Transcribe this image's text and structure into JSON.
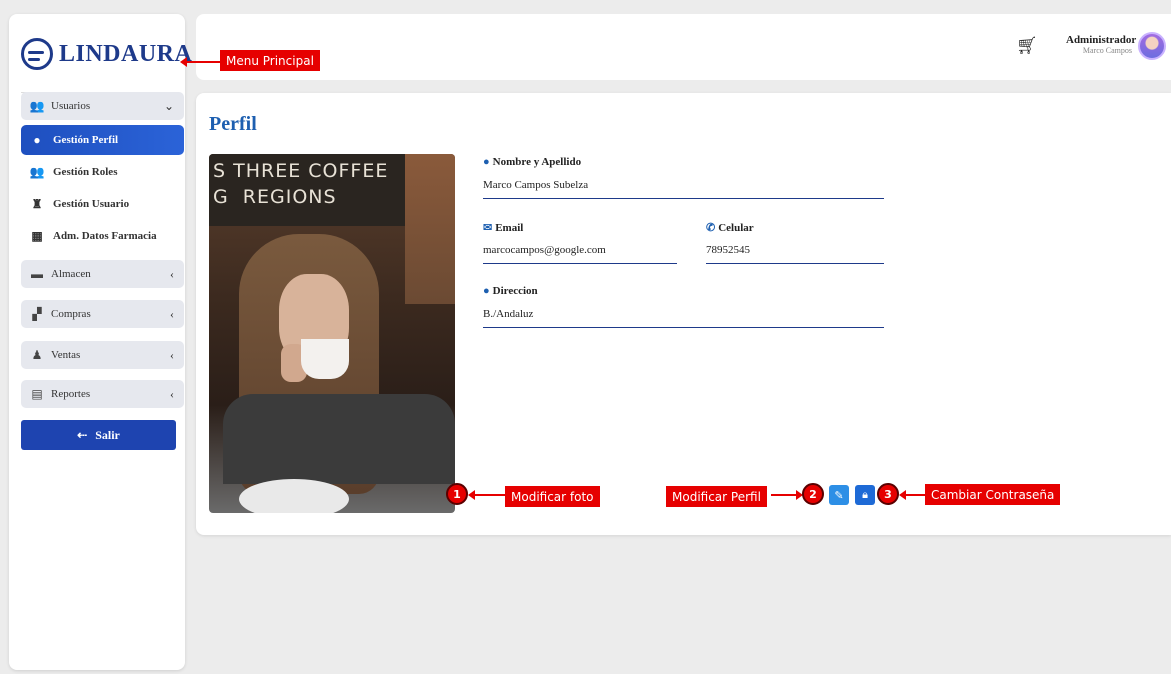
{
  "brand": {
    "name": "LINDAURA"
  },
  "sidebar": {
    "groups": [
      {
        "label": "Usuarios",
        "icon": "users-icon",
        "chevron": "⌄"
      },
      {
        "label": "Almacen",
        "icon": "box-icon",
        "chevron": "‹"
      },
      {
        "label": "Compras",
        "icon": "cart-hand-icon",
        "chevron": "‹"
      },
      {
        "label": "Ventas",
        "icon": "money-bag-icon",
        "chevron": "‹"
      },
      {
        "label": "Reportes",
        "icon": "report-icon",
        "chevron": "‹"
      }
    ],
    "usuarios_items": [
      {
        "label": "Gestión Perfil",
        "icon": "user-circle-icon",
        "active": true
      },
      {
        "label": "Gestión Roles",
        "icon": "users-icon",
        "active": false
      },
      {
        "label": "Gestión Usuario",
        "icon": "user-tie-icon",
        "active": false
      },
      {
        "label": "Adm. Datos Farmacia",
        "icon": "clinic-icon",
        "active": false
      }
    ],
    "logout_label": "Salir"
  },
  "header": {
    "user_role": "Administrador",
    "user_name": "Marco Campos"
  },
  "profile": {
    "title": "Perfil",
    "fields": {
      "name": {
        "label": "Nombre y Apellido",
        "value": "Marco Campos Subelza"
      },
      "email": {
        "label": "Email",
        "value": "marcocampos@google.com"
      },
      "phone": {
        "label": "Celular",
        "value": "78952545"
      },
      "address": {
        "label": "Direccion",
        "value": "B./Andaluz"
      }
    },
    "photo_sign_text": "S THREE COFFEE\nG  REGIONS"
  },
  "annotations": {
    "menu_principal": "Menu Principal",
    "modificar_foto": "Modificar foto",
    "modificar_perfil": "Modificar Perfil",
    "cambiar_contrasena": "Cambiar Contraseña",
    "num1": "1",
    "num2": "2",
    "num3": "3"
  },
  "colors": {
    "brand": "#1e3a8a",
    "accent": "#1d5fb0",
    "active_item": "#2b63d8",
    "annotation": "#e60000",
    "camera_button": "#f4a523",
    "edit_button": "#2d8fe6",
    "lock_button": "#1e6ad6"
  }
}
